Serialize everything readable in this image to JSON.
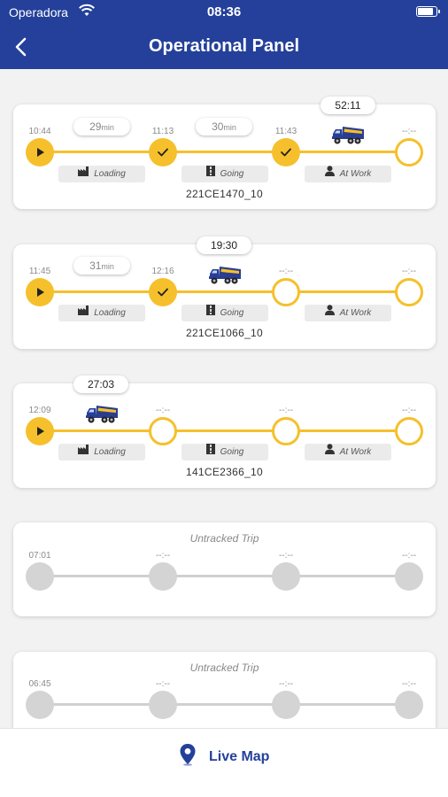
{
  "status_bar": {
    "carrier": "Operadora",
    "clock": "08:36"
  },
  "header": {
    "title": "Operational Panel"
  },
  "colors": {
    "brand": "#24409a",
    "accent": "#f5c02b",
    "inactive": "#d4d4d4"
  },
  "stage_labels": {
    "loading": "Loading",
    "going": "Going",
    "at_work": "At Work"
  },
  "trips": [
    {
      "elapsed": "52:11",
      "times": [
        "10:44",
        "11:13",
        "11:43",
        "--:--"
      ],
      "durations": [
        {
          "value": "29",
          "unit": "min"
        },
        {
          "value": "30",
          "unit": "min"
        }
      ],
      "code": "221CE1470_10"
    },
    {
      "elapsed": "19:30",
      "times": [
        "11:45",
        "12:16",
        "--:--",
        "--:--"
      ],
      "durations": [
        {
          "value": "31",
          "unit": "min"
        }
      ],
      "code": "221CE1066_10"
    },
    {
      "elapsed": "27:03",
      "times": [
        "12:09",
        "--:--",
        "--:--",
        "--:--"
      ],
      "code": "141CE2366_10"
    },
    {
      "label": "Untracked Trip",
      "times": [
        "07:01",
        "--:--",
        "--:--",
        "--:--"
      ]
    },
    {
      "label": "Untracked Trip",
      "times": [
        "06:45",
        "--:--",
        "--:--",
        "--:--"
      ]
    }
  ],
  "bottom": {
    "live_map_label": "Live Map"
  }
}
